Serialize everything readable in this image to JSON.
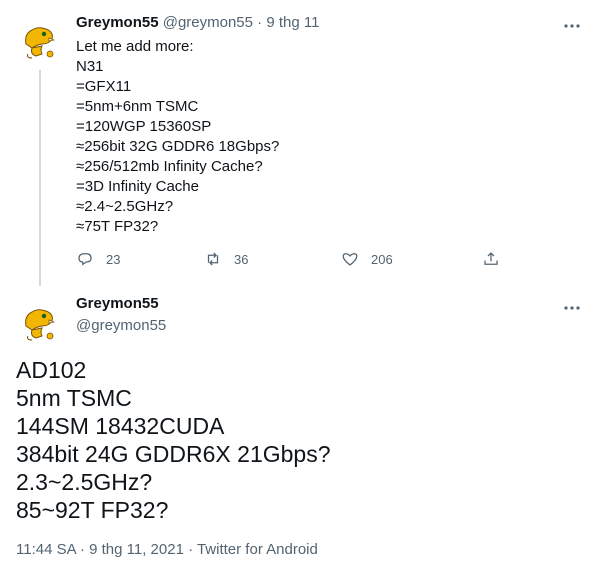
{
  "reply_tweet": {
    "display_name": "Greymon55",
    "handle": "@greymon55",
    "separator": "·",
    "date": "9 thg 11",
    "lines": [
      "Let me add more:",
      "N31",
      "=GFX11",
      "=5nm+6nm TSMC",
      "=120WGP 15360SP",
      "≈256bit 32G GDDR6 18Gbps?",
      "≈256/512mb Infinity Cache?",
      "=3D Infinity Cache",
      "≈2.4~2.5GHz?",
      "≈75T FP32?"
    ],
    "actions": {
      "reply_count": "23",
      "retweet_count": "36",
      "like_count": "206"
    },
    "more_icon": "more-horizontal-icon"
  },
  "main_tweet": {
    "display_name": "Greymon55",
    "handle": "@greymon55",
    "lines": [
      "AD102",
      "5nm TSMC",
      "144SM 18432CUDA",
      "384bit 24G GDDR6X 21Gbps?",
      "2.3~2.5GHz?",
      "85~92T FP32?"
    ],
    "timestamp": "11:44 SA · 9 thg 11, 2021 · Twitter for Android"
  },
  "icons": {
    "reply": "reply-icon",
    "retweet": "retweet-icon",
    "like": "heart-icon",
    "share": "share-icon"
  },
  "colors": {
    "text": "#0f1419",
    "muted": "#536471",
    "thread_line": "#cfd9de",
    "avatar_yellow": "#f2b705"
  }
}
